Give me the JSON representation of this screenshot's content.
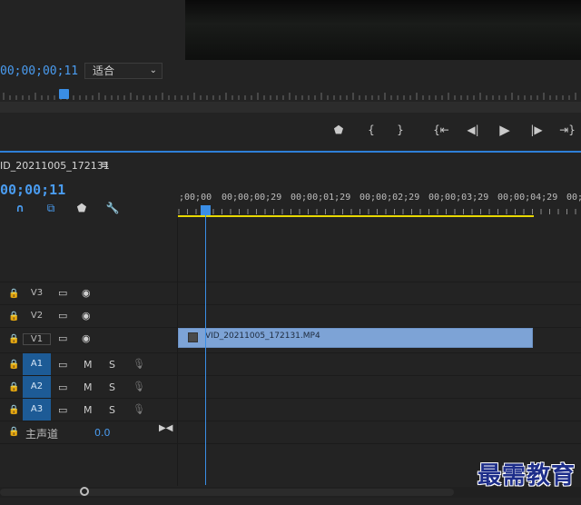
{
  "program_monitor": {
    "timecode": "00;00;00;11",
    "fit_select": {
      "value": "适合"
    }
  },
  "transport": {
    "buttons": [
      {
        "name": "add-marker-button",
        "icon": "marker-icon",
        "glyph": "⬟"
      },
      {
        "name": "mark-in-button",
        "icon": "mark-in-icon",
        "glyph": "{"
      },
      {
        "name": "mark-out-button",
        "icon": "mark-out-icon",
        "glyph": "}"
      },
      {
        "name": "go-to-in-button",
        "icon": "go-to-in-icon",
        "glyph": "{⇤"
      },
      {
        "name": "step-back-button",
        "icon": "step-back-icon",
        "glyph": "◀|"
      },
      {
        "name": "play-button",
        "icon": "play-icon",
        "glyph": "▶"
      },
      {
        "name": "step-forward-button",
        "icon": "step-forward-icon",
        "glyph": "|▶"
      },
      {
        "name": "go-to-out-button",
        "icon": "go-to-out-icon",
        "glyph": "⇥}"
      }
    ]
  },
  "sequence": {
    "tab_name": "ID_20211005_172131",
    "tab_menu": "≡",
    "timecode": "00;00;11",
    "ruler_labels": [
      ";00;00",
      "00;00;00;29",
      "00;00;01;29",
      "00;00;02;29",
      "00;00;03;29",
      "00;00;04;29",
      "00;"
    ],
    "tools": [
      {
        "name": "snap-icon",
        "glyph": "∩"
      },
      {
        "name": "linked-selection-icon",
        "glyph": "⧉"
      },
      {
        "name": "add-marker-icon",
        "glyph": "⬟"
      },
      {
        "name": "wrench-icon",
        "glyph": "🔧"
      }
    ]
  },
  "tracks": {
    "video": [
      {
        "label": "V3",
        "icons": [
          "film-icon",
          "eye-icon"
        ]
      },
      {
        "label": "V2",
        "icons": [
          "film-icon",
          "eye-icon"
        ]
      },
      {
        "label": "V1",
        "icons": [
          "film-icon",
          "eye-icon"
        ]
      }
    ],
    "audio": [
      {
        "label": "A1",
        "mute": "M",
        "solo": "S"
      },
      {
        "label": "A2",
        "mute": "M",
        "solo": "S"
      },
      {
        "label": "A3",
        "mute": "M",
        "solo": "S"
      }
    ],
    "master": {
      "label": "主声道",
      "value": "0.0"
    }
  },
  "clip": {
    "name": "VID_20211005_172131.MP4",
    "fx": "fx",
    "color": "#7da3d6"
  },
  "watermark": "最需教育",
  "colors": {
    "accent": "#3a8ee6",
    "work_area": "#e8d800",
    "audio_track": "#1d5b96"
  }
}
